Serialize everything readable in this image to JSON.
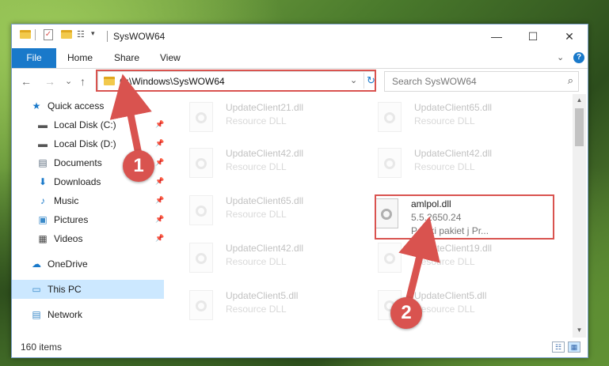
{
  "window": {
    "title": "SysWOW64",
    "minimize": "—",
    "maximize": "☐",
    "close": "✕"
  },
  "ribbon": {
    "tabs": [
      "File",
      "Home",
      "Share",
      "View"
    ],
    "expand_glyph": "⌄",
    "help_glyph": "?"
  },
  "nav": {
    "back": "←",
    "forward": "→",
    "recent": "⌄",
    "up": "↑",
    "address": "C:\\Windows\\SysWOW64",
    "address_dropdown": "⌄",
    "refresh": "↻",
    "search_placeholder": "Search SysWOW64",
    "search_glyph": "⌕"
  },
  "sidebar": {
    "items": [
      {
        "label": "Quick access",
        "icon": "star-icon",
        "glyph": "★",
        "color": "#1979ca",
        "pinned": false
      },
      {
        "label": "Local Disk (C:)",
        "icon": "drive-icon",
        "glyph": "▬",
        "color": "#555555",
        "pinned": true
      },
      {
        "label": "Local Disk (D:)",
        "icon": "drive-icon",
        "glyph": "▬",
        "color": "#555555",
        "pinned": true
      },
      {
        "label": "Documents",
        "icon": "documents-icon",
        "glyph": "▤",
        "color": "#5a6b7d",
        "pinned": true
      },
      {
        "label": "Downloads",
        "icon": "downloads-icon",
        "glyph": "⬇",
        "color": "#1979ca",
        "pinned": true
      },
      {
        "label": "Music",
        "icon": "music-icon",
        "glyph": "♪",
        "color": "#1979ca",
        "pinned": true
      },
      {
        "label": "Pictures",
        "icon": "pictures-icon",
        "glyph": "▣",
        "color": "#3a8ac9",
        "pinned": true
      },
      {
        "label": "Videos",
        "icon": "videos-icon",
        "glyph": "▦",
        "color": "#444444",
        "pinned": true
      },
      {
        "label": "OneDrive",
        "icon": "onedrive-icon",
        "glyph": "☁",
        "color": "#1979ca",
        "pinned": false
      },
      {
        "label": "This PC",
        "icon": "computer-icon",
        "glyph": "▭",
        "color": "#3a8ac9",
        "pinned": false,
        "selected": true
      },
      {
        "label": "Network",
        "icon": "network-icon",
        "glyph": "▤",
        "color": "#3a8ac9",
        "pinned": false
      }
    ],
    "pin_glyph": "📌"
  },
  "files": {
    "left": [
      {
        "name": "UpdateClient21.dll",
        "desc": "Resource DLL"
      },
      {
        "name": "UpdateClient42.dll",
        "desc": "Resource DLL"
      },
      {
        "name": "UpdateClient65.dll",
        "desc": "Resource DLL"
      },
      {
        "name": "UpdateClient42.dll",
        "desc": "Resource DLL"
      },
      {
        "name": "UpdateClient5.dll",
        "desc": "Resource DLL"
      }
    ],
    "right": [
      {
        "name": "UpdateClient65.dll",
        "desc": "Resource DLL"
      },
      {
        "name": "UpdateClient42.dll",
        "desc": "Resource DLL"
      },
      {
        "name": "UpdateClient19.dll",
        "desc": "Resource DLL"
      },
      {
        "name": "UpdateClient5.dll",
        "desc": "Resource DLL"
      }
    ],
    "featured": {
      "name": "amlpol.dll",
      "version": "5.5.2650.24",
      "desc": "Polski pakiet j   Pr..."
    }
  },
  "scroll": {
    "up": "▲",
    "down": "▼"
  },
  "status": {
    "count": "160 items",
    "details_glyph": "☷",
    "tiles_glyph": "▦"
  },
  "callouts": {
    "step1": "1",
    "step2": "2"
  },
  "colors": {
    "accent": "#1979ca",
    "highlight": "#d9534f"
  }
}
